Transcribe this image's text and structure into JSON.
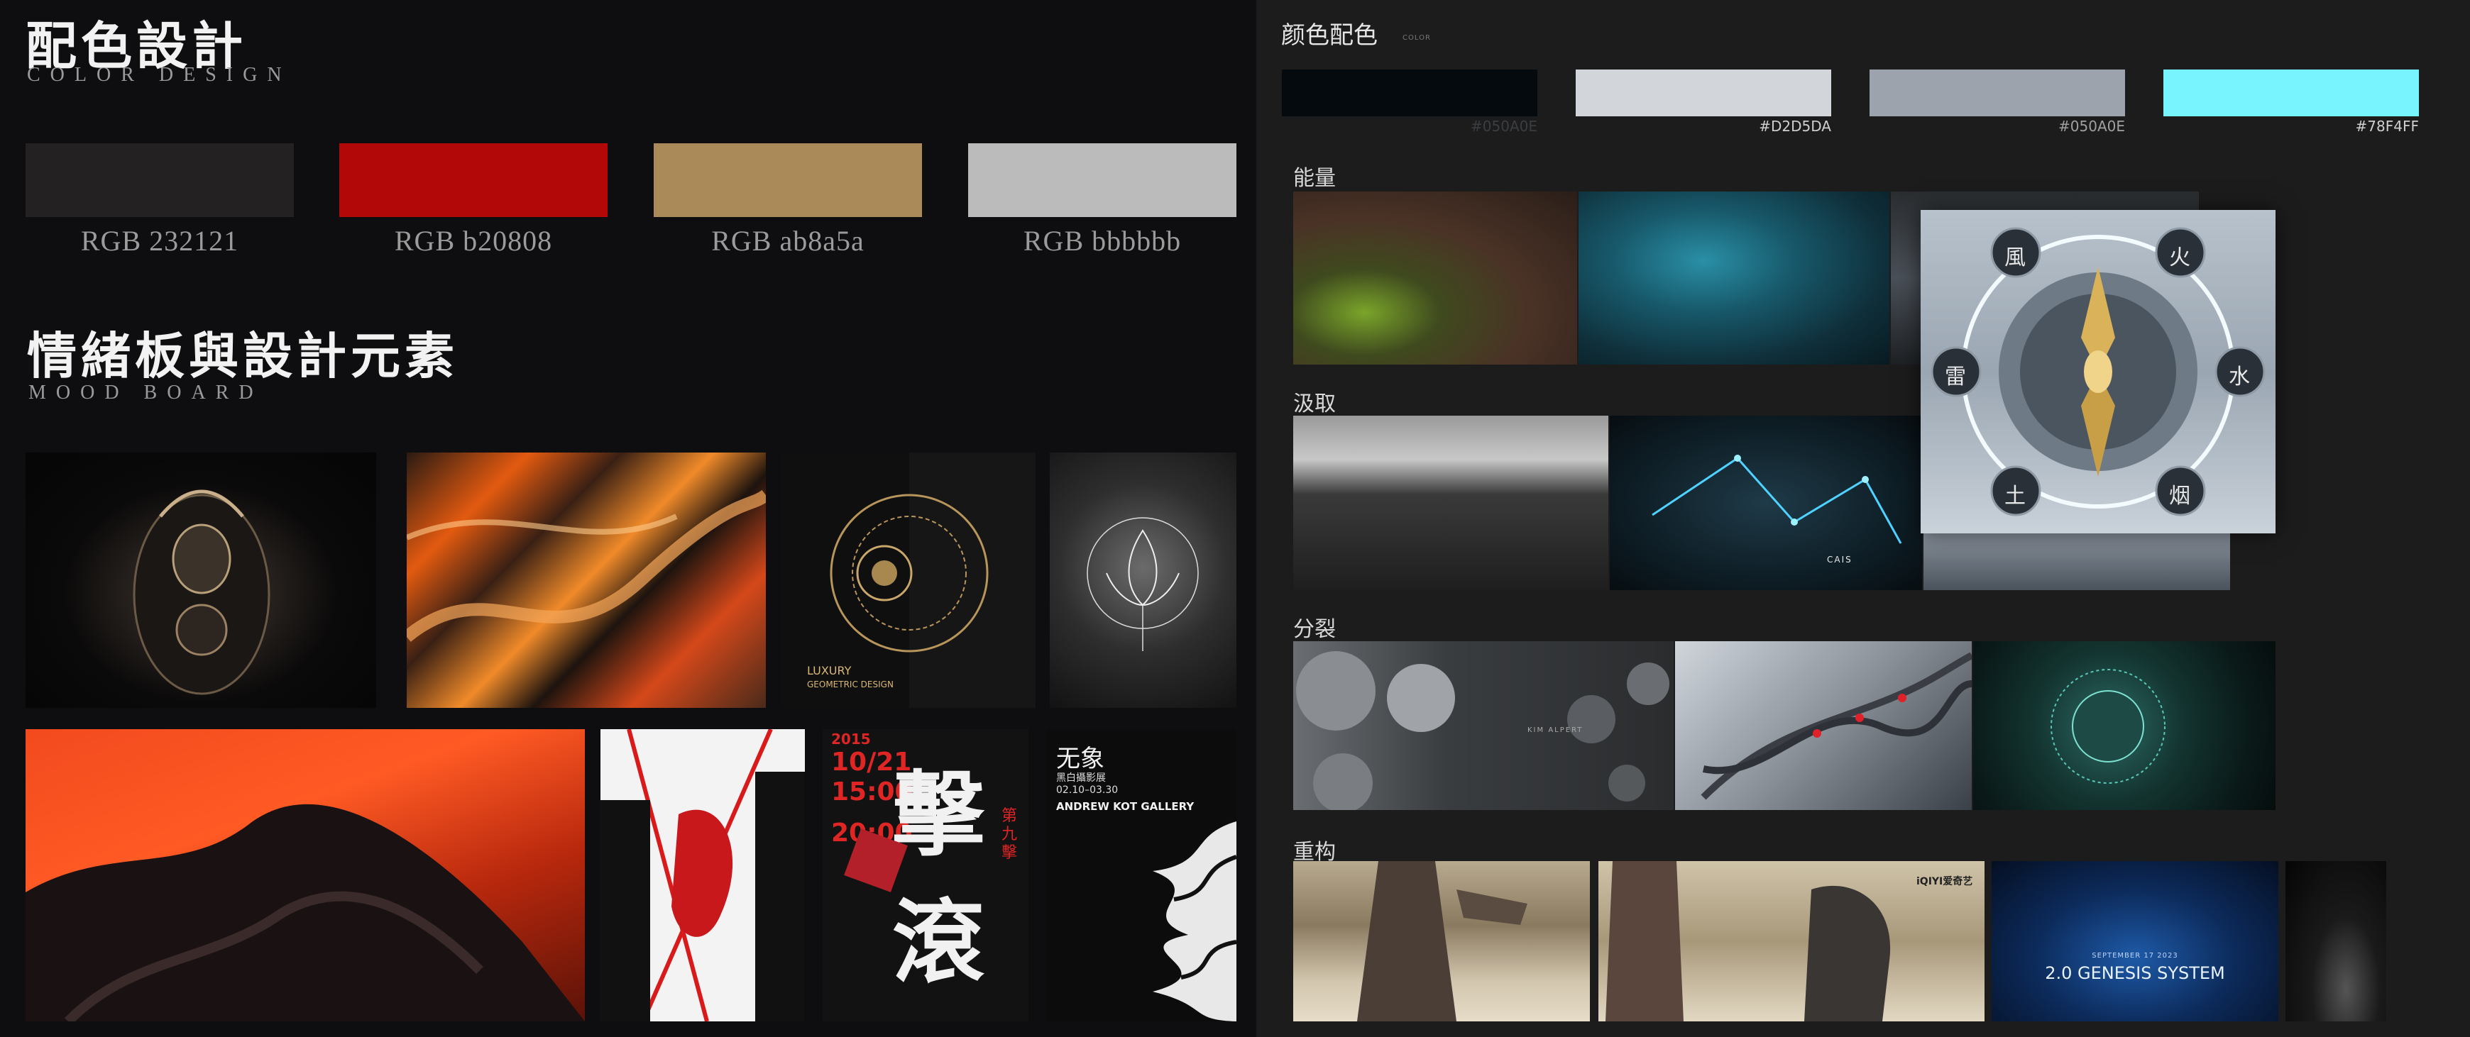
{
  "left": {
    "color_title_cn": "配色設計",
    "color_title_en": "COLOR DESIGN",
    "swatches": [
      {
        "label": "RGB 232121",
        "color": "#232121"
      },
      {
        "label": "RGB b20808",
        "color": "#b20808"
      },
      {
        "label": "RGB ab8a5a",
        "color": "#ab8a5a"
      },
      {
        "label": "RGB bbbbbb",
        "color": "#bbbbbb"
      }
    ],
    "mood_title_cn": "情緒板與設計元素",
    "mood_title_en": "MOOD BOARD",
    "poster_luxury": "LUXURY",
    "poster_geometric": "GEOMETRIC DESIGN",
    "poster_date_1": "10/21",
    "poster_time_1": "15:00",
    "poster_time_2": "20:00",
    "poster_year": "2015",
    "poster_big_1": "擊",
    "poster_big_2": "滾",
    "poster_side": "第九擊",
    "poster_wuxiang": "无象",
    "poster_wuxiang_sub": "黑白攝影展",
    "poster_wuxiang_date": "02.10–03.30",
    "poster_gallery": "ANDREW KOT GALLERY"
  },
  "right": {
    "title": "颜色配色",
    "subtitle": "COLOR",
    "colors": [
      {
        "hex": "#050A0E",
        "color": "#050a0e"
      },
      {
        "hex": "#D2D5DA",
        "color": "#d2d5da"
      },
      {
        "hex": "#050A0E",
        "color": "#9ca3ad"
      },
      {
        "hex": "#78F4FF",
        "color": "#78f4ff"
      }
    ],
    "sections": [
      "能量",
      "汲取",
      "分裂",
      "重构"
    ],
    "emblem_chars": [
      "風",
      "火",
      "雷",
      "水",
      "土",
      "烟"
    ],
    "caption_cais": "CAIS",
    "caption_genesis": "2.0 GENESIS SYSTEM",
    "caption_genesis_date": "SEPTEMBER 17 2023",
    "caption_kim": "KIM ALPERT",
    "caption_iqiyi": "iQIYI爱奇艺"
  }
}
